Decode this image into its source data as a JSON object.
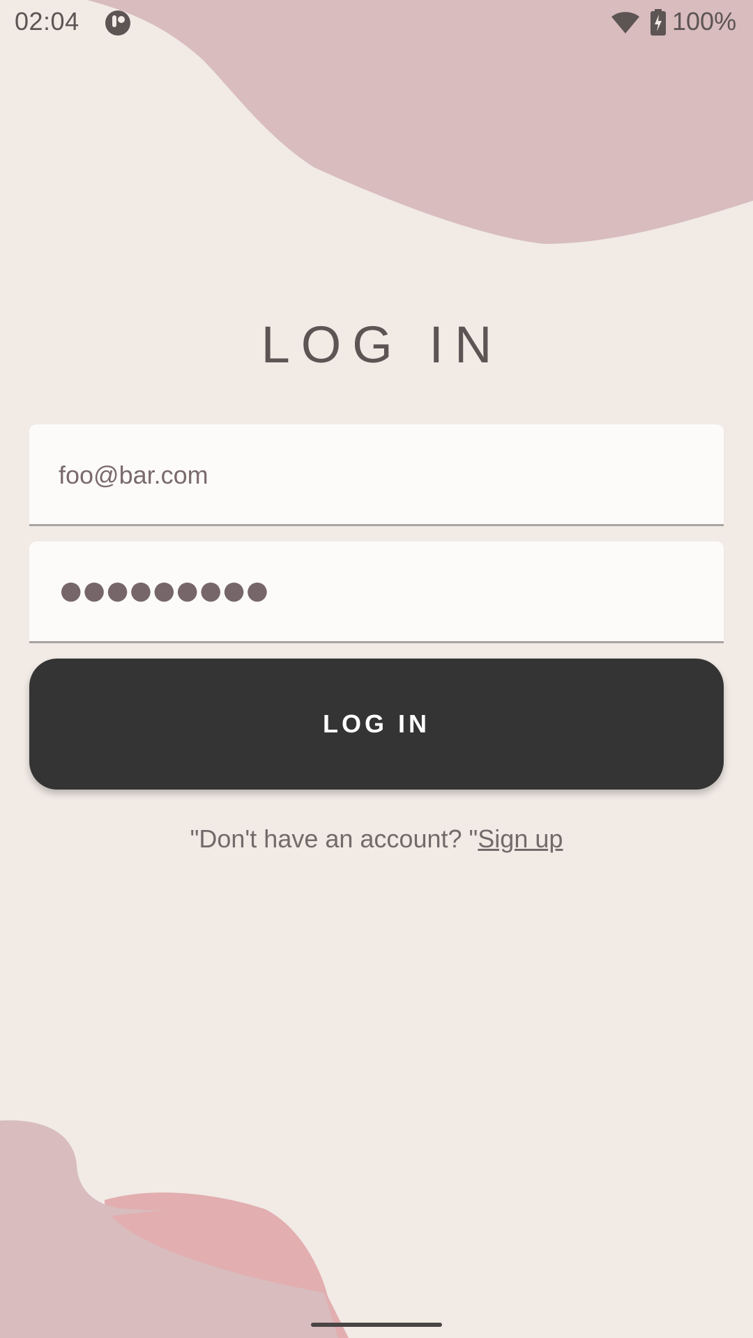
{
  "status_bar": {
    "time": "02:04",
    "battery_text": "100%",
    "icons": [
      "app-notification-icon",
      "wifi-icon",
      "battery-charging-icon"
    ]
  },
  "title": "LOG IN",
  "form": {
    "email_value": "foo@bar.com",
    "password_masked": "●●●●●●●●●",
    "button_label": "LOG IN"
  },
  "signup": {
    "prompt": "\"Don't have an account? \"",
    "link": "Sign up"
  },
  "colors": {
    "background": "#F1EAE5",
    "blob_mauve": "#D8BCBE",
    "blob_pink": "#E2AEB0",
    "button": "#343434",
    "text": "#5D5454",
    "field": "#FDFBFA"
  }
}
